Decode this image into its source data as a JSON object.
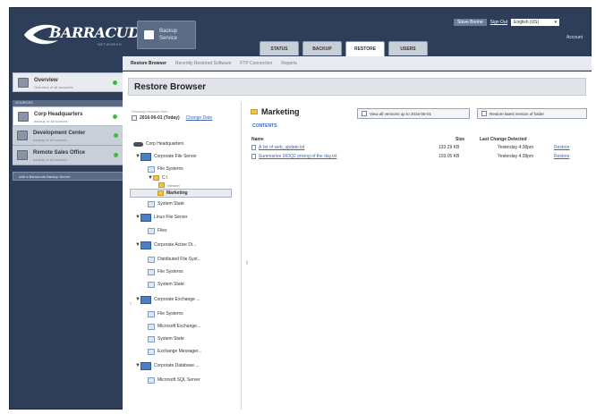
{
  "app": {
    "brand_name": "BARRACUDA",
    "brand_sub": "NETWORKS",
    "backup_service_label": "Backup Service"
  },
  "userbar": {
    "user": "Steve Boone",
    "sign_out": "Sign Out",
    "language": "English (US)",
    "account": "Account"
  },
  "main_tabs": [
    {
      "label": "STATUS",
      "active": false
    },
    {
      "label": "BACKUP",
      "active": false
    },
    {
      "label": "RESTORE",
      "active": true
    },
    {
      "label": "USERS",
      "active": false
    }
  ],
  "subnav": [
    {
      "label": "Restore Browser",
      "active": true
    },
    {
      "label": "Recently Restored Software",
      "active": false
    },
    {
      "label": "FTP Connection",
      "active": false
    },
    {
      "label": "Reports",
      "active": false
    }
  ],
  "sidebar": {
    "overview": {
      "title": "Overview",
      "sub": "Overview of all accounts"
    },
    "section_label": "SOURCES",
    "items": [
      {
        "title": "Corp Headquarters",
        "sub": "backup of all sources",
        "selected": true
      },
      {
        "title": "Development Center",
        "sub": "backup of all sources",
        "selected": false
      },
      {
        "title": "Remote Sales Office",
        "sub": "backup of all sources",
        "selected": false
      }
    ],
    "add_link": "Add a Barracuda Backup Server"
  },
  "page": {
    "title": "Restore Browser",
    "showing_label": "Showing backups from",
    "date_value": "2016-06-01 (Today)",
    "change_date": "Change Date"
  },
  "tree": {
    "root": "Corp Headquarters",
    "nodes": [
      {
        "label": "Corporate File Server",
        "icon": "server-icon",
        "twisty": "▼"
      },
      {
        "label": "File Systems",
        "icon": "disk-icon",
        "twisty": ""
      },
      {
        "label": "C:\\",
        "icon": "folder-icon",
        "twisty": "▼"
      },
      {
        "label": "Intranet",
        "icon": "folder-icon",
        "twisty": ""
      },
      {
        "label": "Marketing",
        "icon": "folder-icon",
        "twisty": "",
        "selected": true
      },
      {
        "label": "System State",
        "icon": "disk-icon",
        "twisty": ""
      },
      {
        "label": "Linux File Server",
        "icon": "server-icon",
        "twisty": "▼"
      },
      {
        "label": "Files",
        "icon": "disk-icon",
        "twisty": ""
      },
      {
        "label": "Corporate Active Di...",
        "icon": "server-icon",
        "twisty": "▼"
      },
      {
        "label": "Distributed File Syst...",
        "icon": "disk-icon",
        "twisty": ""
      },
      {
        "label": "File Systems",
        "icon": "disk-icon",
        "twisty": ""
      },
      {
        "label": "System State",
        "icon": "disk-icon",
        "twisty": ""
      },
      {
        "label": "Corporate Exchange ...",
        "icon": "server-icon",
        "twisty": "▼"
      },
      {
        "label": "File Systems",
        "icon": "disk-icon",
        "twisty": ""
      },
      {
        "label": "Microsoft Exchange...",
        "icon": "disk-icon",
        "twisty": ""
      },
      {
        "label": "System State",
        "icon": "disk-icon",
        "twisty": ""
      },
      {
        "label": "Exchange Messager...",
        "icon": "disk-icon",
        "twisty": ""
      },
      {
        "label": "Corporate Database ...",
        "icon": "server-icon",
        "twisty": "▼"
      },
      {
        "label": "Microsoft SQL Server",
        "icon": "disk-icon",
        "twisty": ""
      }
    ]
  },
  "folder": {
    "name": "Marketing",
    "contents_label": "CONTENTS",
    "view_all_btn": "View all versions up to 2016-06-01",
    "restore_btn": "Restore latest version of folder"
  },
  "table": {
    "headers": {
      "name": "Name",
      "size": "Size",
      "date": "Last Change Detected"
    },
    "rows": [
      {
        "name": "A list of web_update.txt",
        "size": "133.29 KB",
        "date": "Yesterday 4:38pm",
        "action": "Restore"
      },
      {
        "name": "Summarize 360Q2 pricing of the day.txt",
        "size": "103.05 KB",
        "date": "Yesterday 4:38pm",
        "action": "Restore"
      }
    ]
  },
  "colors": {
    "frame": "#2e3e59",
    "accent_link": "#3b66b8",
    "status_ok": "#3bbf3b"
  }
}
